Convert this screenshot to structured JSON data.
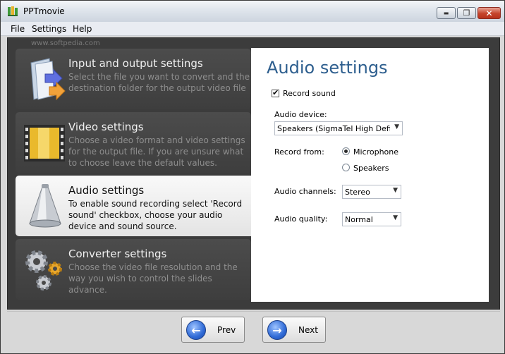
{
  "window": {
    "title": "PPTmovie",
    "controls": {
      "minimize": "▬",
      "maximize": "❐",
      "close": "✕"
    }
  },
  "menu": [
    "File",
    "Settings",
    "Help"
  ],
  "watermark": "www.softpedia.com",
  "steps": [
    {
      "title": "Input and output settings",
      "description": "Select the file you want to convert and the destination folder for the output video file",
      "icon": "folder-arrow-icon"
    },
    {
      "title": "Video settings",
      "description": "Choose a video format and video settings for the output file. If you are unsure what to choose leave the default values.",
      "icon": "film-strip-icon"
    },
    {
      "title": "Audio settings",
      "description": "To enable sound recording select 'Record sound' checkbox, choose your audio device and sound source.",
      "icon": "megaphone-icon",
      "active": true
    },
    {
      "title": "Converter settings",
      "description": "Choose the video file resolution and the way you wish to control the slides advance.",
      "icon": "gears-icon"
    }
  ],
  "panel": {
    "title": "Audio settings",
    "record_sound": {
      "label": "Record sound",
      "checked": true,
      "mark": "✔"
    },
    "audio_device": {
      "label": "Audio device:",
      "value": "Speakers (SigmaTel High Definit"
    },
    "record_from": {
      "label": "Record from:",
      "options": [
        "Microphone",
        "Speakers"
      ],
      "selected": "Microphone"
    },
    "audio_channels": {
      "label": "Audio channels:",
      "value": "Stereo"
    },
    "audio_quality": {
      "label": "Audio quality:",
      "value": "Normal"
    },
    "dropdown_arrow": "▼"
  },
  "nav": {
    "prev": {
      "label": "Prev",
      "arrow": "←"
    },
    "next": {
      "label": "Next",
      "arrow": "→"
    }
  },
  "colors": {
    "accent_title": "#2d5e8e",
    "dark_panel": "#3c3c3c",
    "active_step": "#f4f4f4"
  }
}
